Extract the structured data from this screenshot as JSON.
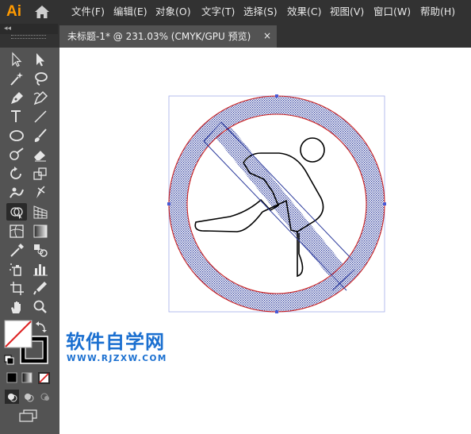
{
  "app": {
    "logo": "Ai"
  },
  "menu": [
    "文件(F)",
    "编辑(E)",
    "对象(O)",
    "文字(T)",
    "选择(S)",
    "效果(C)",
    "视图(V)",
    "窗口(W)",
    "帮助(H)"
  ],
  "document_tab": {
    "title": "未标题-1* @ 231.03% (CMYK/GPU 预览)",
    "close": "×"
  },
  "panel": {
    "collapse": "◂◂"
  },
  "tools": [
    {
      "icon": "selection-tool-icon"
    },
    {
      "icon": "direct-selection-tool-icon"
    },
    {
      "icon": "magic-wand-tool-icon"
    },
    {
      "icon": "lasso-tool-icon"
    },
    {
      "icon": "pen-tool-icon"
    },
    {
      "icon": "curvature-tool-icon"
    },
    {
      "icon": "type-tool-icon"
    },
    {
      "icon": "line-segment-tool-icon"
    },
    {
      "icon": "ellipse-tool-icon"
    },
    {
      "icon": "paintbrush-tool-icon"
    },
    {
      "icon": "shaper-tool-icon"
    },
    {
      "icon": "eraser-tool-icon"
    },
    {
      "icon": "rotate-tool-icon"
    },
    {
      "icon": "scale-tool-icon"
    },
    {
      "icon": "warp-tool-icon"
    },
    {
      "icon": "free-transform-tool-icon"
    },
    {
      "icon": "shape-builder-tool-icon"
    },
    {
      "icon": "perspective-grid-tool-icon"
    },
    {
      "icon": "mesh-tool-icon"
    },
    {
      "icon": "gradient-tool-icon"
    },
    {
      "icon": "eyedropper-tool-icon"
    },
    {
      "icon": "blend-tool-icon"
    },
    {
      "icon": "symbol-sprayer-tool-icon"
    },
    {
      "icon": "column-graph-tool-icon"
    },
    {
      "icon": "artboard-tool-icon"
    },
    {
      "icon": "slice-tool-icon"
    },
    {
      "icon": "hand-tool-icon"
    },
    {
      "icon": "zoom-tool-icon"
    }
  ],
  "active_tool": "shape-builder-tool-icon",
  "colors": {
    "accent": "#ff9a00",
    "selection_blue": "#2b3a9c",
    "path_red": "#cc2222",
    "watermark": "#1a6fd0"
  },
  "watermark": {
    "title": "软件自学网",
    "url": "WWW.RJZXW.COM"
  }
}
